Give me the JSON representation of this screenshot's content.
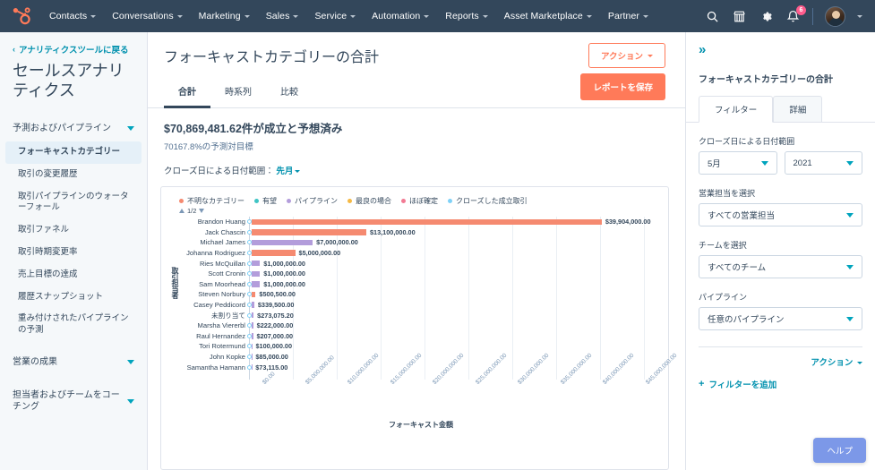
{
  "topnav": {
    "logo_icon": "hubspot-sprocket-logo",
    "items": [
      {
        "label": "Contacts",
        "has_caret": true
      },
      {
        "label": "Conversations",
        "has_caret": true
      },
      {
        "label": "Marketing",
        "has_caret": true
      },
      {
        "label": "Sales",
        "has_caret": true
      },
      {
        "label": "Service",
        "has_caret": true
      },
      {
        "label": "Automation",
        "has_caret": true
      },
      {
        "label": "Reports",
        "has_caret": true
      },
      {
        "label": "Asset Marketplace",
        "has_caret": true
      },
      {
        "label": "Partner",
        "has_caret": true
      }
    ],
    "icons": [
      "search-icon",
      "marketplace-icon",
      "gear-icon",
      "notifications-bell-icon"
    ],
    "notification_count": "6"
  },
  "sidebar": {
    "back_link": "アナリティクスツールに戻る",
    "title": "セールスアナリティクス",
    "groups": [
      {
        "label": "予測およびパイプライン",
        "expanded": true,
        "items": [
          {
            "label": "フォーキャストカテゴリー",
            "active": true
          },
          {
            "label": "取引の変更履歴",
            "active": false
          },
          {
            "label": "取引パイプラインのウォーターフォール",
            "active": false
          },
          {
            "label": "取引ファネル",
            "active": false
          },
          {
            "label": "取引時期変更率",
            "active": false
          },
          {
            "label": "売上目標の達成",
            "active": false
          },
          {
            "label": "履歴スナップショット",
            "active": false
          },
          {
            "label": "重み付けされたパイプラインの予測",
            "active": false
          }
        ]
      },
      {
        "label": "営業の成果",
        "expanded": false,
        "items": []
      },
      {
        "label": "担当者およびチームをコーチング",
        "expanded": false,
        "items": []
      }
    ]
  },
  "main": {
    "page_title": "フォーキャストカテゴリーの合計",
    "action_button": "アクション",
    "save_button": "レポートを保存",
    "tabs": [
      {
        "label": "合計",
        "active": true
      },
      {
        "label": "時系列",
        "active": false
      },
      {
        "label": "比較",
        "active": false
      }
    ],
    "stat_main": "$70,869,481.62件が成立と予想済み",
    "stat_sub": "70167.8%の予測対目標",
    "daterange_label": "クローズ日による日付範囲：",
    "daterange_value": "先月",
    "pager": "1/2"
  },
  "chart_data": {
    "type": "bar",
    "orientation": "horizontal",
    "stacked": true,
    "title": "フォーキャストカテゴリーの合計",
    "xlabel": "フォーキャスト金額",
    "ylabel": "取引担当者",
    "xlim": [
      0,
      46500000
    ],
    "xticks": [
      "$0.00",
      "$5,000,000.00",
      "$10,000,000.00",
      "$15,000,000.00",
      "$20,000,000.00",
      "$25,000,000.00",
      "$30,000,000.00",
      "$35,000,000.00",
      "$40,000,000.00",
      "$45,000,000.00"
    ],
    "xtick_values": [
      0,
      5000000,
      10000000,
      15000000,
      20000000,
      25000000,
      30000000,
      35000000,
      40000000,
      45000000
    ],
    "grid": true,
    "legend_position": "top",
    "legend": [
      {
        "name": "不明なカテゴリー",
        "color": "#f58a70"
      },
      {
        "name": "有望",
        "color": "#3fc4c4"
      },
      {
        "name": "パイプライン",
        "color": "#b39ddb"
      },
      {
        "name": "最良の場合",
        "color": "#f5b944"
      },
      {
        "name": "ほぼ確定",
        "color": "#f27a93"
      },
      {
        "name": "クローズした成立取引",
        "color": "#7fd1f7"
      }
    ],
    "categories": [
      "Brandon Huang",
      "Jack Chascin",
      "Michael James",
      "Johanna Rodriguez",
      "Ries McQuillan",
      "Scott Cronin",
      "Sam Moorhead",
      "Steven Norbury",
      "Casey Peddicord",
      "未割り当て",
      "Marsha Viererbl",
      "Raul Hernandez",
      "Tori Rotermund",
      "John Kopke",
      "Samantha Hamann"
    ],
    "values": [
      39904000.0,
      13100000.0,
      7000000.0,
      5000000.0,
      1000000.0,
      1000000.0,
      1000000.0,
      500500.0,
      339500.0,
      273075.2,
      222000.0,
      207000.0,
      100000.0,
      85000.0,
      73115.0
    ],
    "value_labels": [
      "$39,904,000.00",
      "$13,100,000.00",
      "$7,000,000.00",
      "$5,000,000.00",
      "$1,000,000.00",
      "$1,000,000.00",
      "$1,000,000.00",
      "$500,500.00",
      "$339,500.00",
      "$273,075.20",
      "$222,000.00",
      "$207,000.00",
      "$100,000.00",
      "$85,000.00",
      "$73,115.00"
    ],
    "bar_colors": [
      "#f58a70",
      "#f58a70",
      "#b39ddb",
      "#f58a70",
      "#b39ddb",
      "#b39ddb",
      "#b39ddb",
      "#f58a70",
      "#b39ddb",
      "#b39ddb",
      "#b39ddb",
      "#b39ddb",
      "#b39ddb",
      "#b39ddb",
      "#b39ddb"
    ]
  },
  "rightpanel": {
    "collapse_icon": "chevron-double-right-icon",
    "title": "フォーキャストカテゴリーの合計",
    "tabs": [
      {
        "label": "フィルター",
        "active": true
      },
      {
        "label": "詳細",
        "active": false
      }
    ],
    "daterange_label": "クローズ日による日付範囲",
    "month_value": "5月",
    "year_value": "2021",
    "rep_label": "営業担当を選択",
    "rep_value": "すべての営業担当",
    "team_label": "チームを選択",
    "team_value": "すべてのチーム",
    "pipeline_label": "パイプライン",
    "pipeline_value": "任意のパイプライン",
    "action_link": "アクション",
    "add_filter": "フィルターを追加",
    "help_button": "ヘルプ"
  }
}
